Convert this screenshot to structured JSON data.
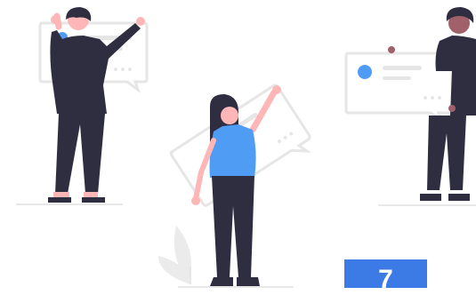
{
  "badge": {
    "value": "7"
  },
  "colors": {
    "accent": "#4f9cf5",
    "badge": "#3c7be6",
    "dark": "#2f2e41",
    "skin": "#ffb6b6",
    "card_stroke": "#e6e6e6",
    "card_fill": "#ffffff",
    "line": "#e0e0e0",
    "leaf": "#ebebeb"
  },
  "icons": [
    "person-left-icon",
    "person-center-icon",
    "person-right-icon",
    "chat-card-icon",
    "plant-icon"
  ]
}
